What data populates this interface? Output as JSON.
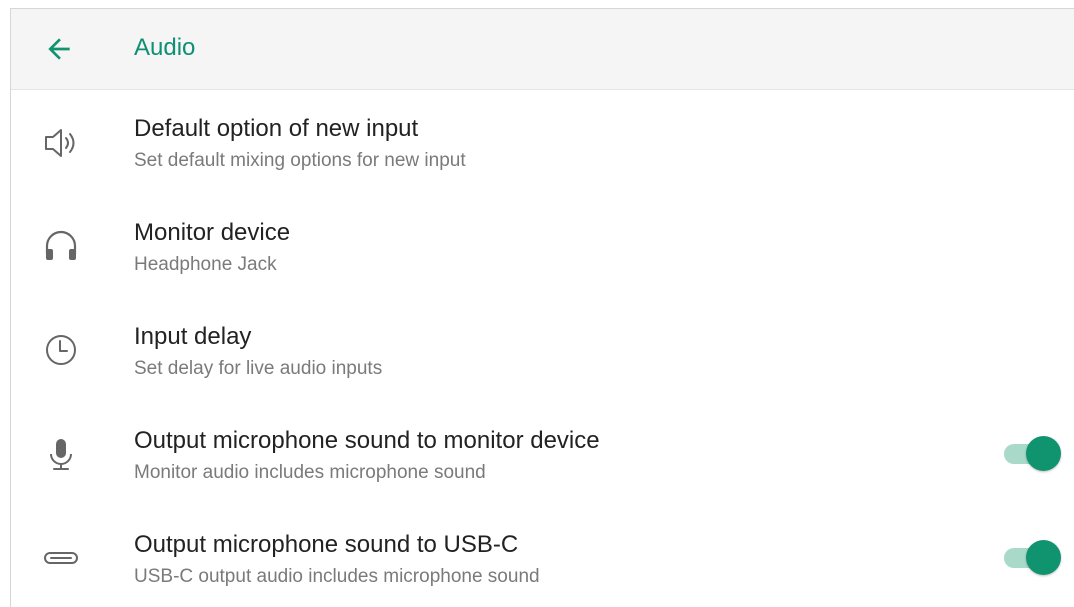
{
  "header": {
    "title": "Audio",
    "back_icon": "arrow-left-icon"
  },
  "colors": {
    "accent": "#10936f",
    "title_text": "#0f8f74",
    "toggle_track": "#a8d9c9",
    "primary_text": "#222222",
    "secondary_text": "#7a7a7a"
  },
  "settings": [
    {
      "icon": "speaker-icon",
      "title": "Default option of new input",
      "subtitle": "Set default mixing options for new input"
    },
    {
      "icon": "headphones-icon",
      "title": "Monitor device",
      "subtitle": "Headphone Jack"
    },
    {
      "icon": "clock-icon",
      "title": "Input delay",
      "subtitle": "Set delay for live audio inputs"
    },
    {
      "icon": "microphone-icon",
      "title": "Output microphone sound to monitor device",
      "subtitle": "Monitor audio includes microphone sound",
      "toggle_on": true
    },
    {
      "icon": "usb-c-icon",
      "title": "Output microphone sound to USB-C",
      "subtitle": "USB-C output audio includes microphone sound",
      "toggle_on": true
    }
  ]
}
